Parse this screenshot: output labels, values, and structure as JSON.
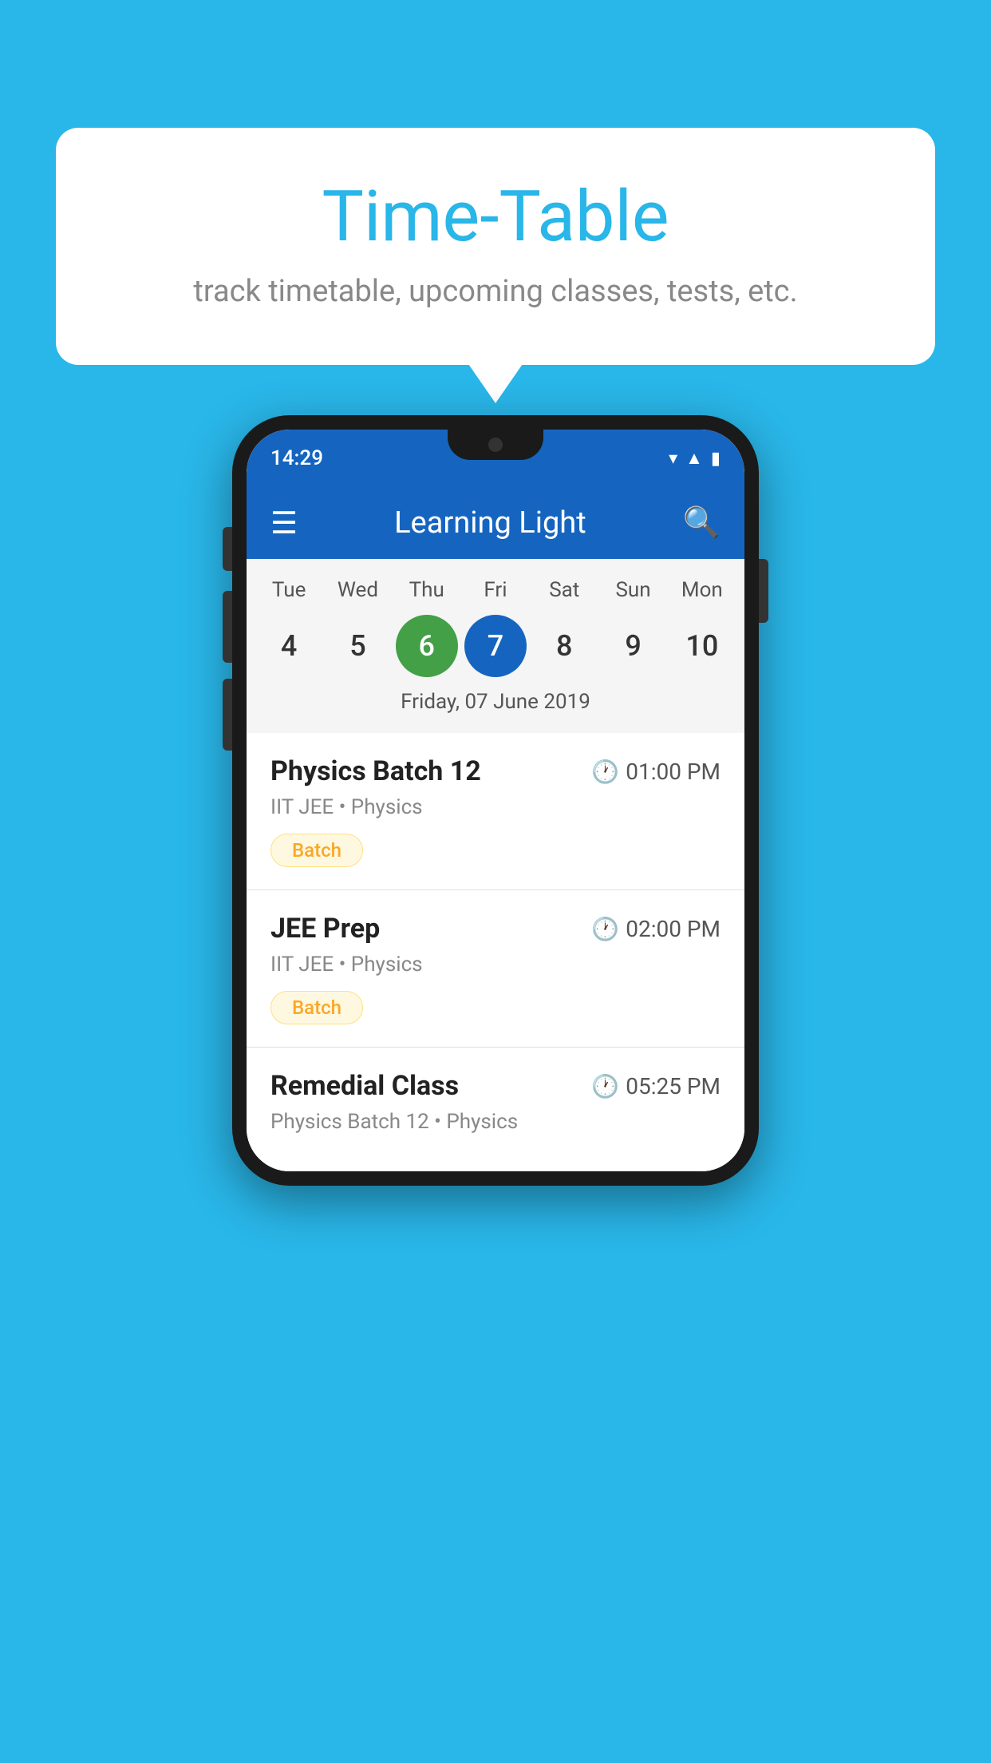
{
  "page": {
    "background_color": "#29b6e8"
  },
  "speech_bubble": {
    "title": "Time-Table",
    "subtitle": "track timetable, upcoming classes, tests, etc."
  },
  "phone": {
    "status_bar": {
      "time": "14:29"
    },
    "app_bar": {
      "title": "Learning Light"
    },
    "calendar": {
      "days": [
        {
          "label": "Tue",
          "num": "4",
          "state": "normal"
        },
        {
          "label": "Wed",
          "num": "5",
          "state": "normal"
        },
        {
          "label": "Thu",
          "num": "6",
          "state": "today"
        },
        {
          "label": "Fri",
          "num": "7",
          "state": "selected"
        },
        {
          "label": "Sat",
          "num": "8",
          "state": "normal"
        },
        {
          "label": "Sun",
          "num": "9",
          "state": "normal"
        },
        {
          "label": "Mon",
          "num": "10",
          "state": "normal"
        }
      ],
      "selected_date_label": "Friday, 07 June 2019"
    },
    "classes": [
      {
        "name": "Physics Batch 12",
        "time": "01:00 PM",
        "subtitle": "IIT JEE • Physics",
        "badge": "Batch"
      },
      {
        "name": "JEE Prep",
        "time": "02:00 PM",
        "subtitle": "IIT JEE • Physics",
        "badge": "Batch"
      },
      {
        "name": "Remedial Class",
        "time": "05:25 PM",
        "subtitle": "Physics Batch 12 • Physics",
        "badge": null
      }
    ]
  }
}
